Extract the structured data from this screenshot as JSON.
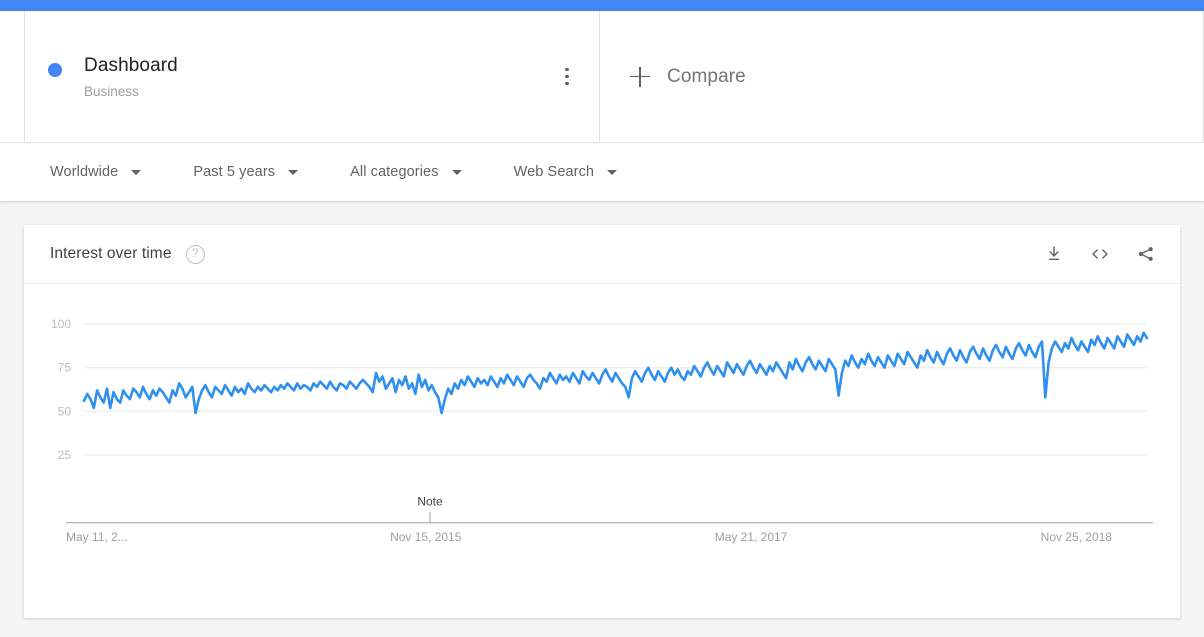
{
  "topbar": {
    "color": "#4285f4"
  },
  "query": {
    "dot_color": "#4285f4",
    "title": "Dashboard",
    "subtitle": "Business",
    "menu_icon": "more-vert-icon"
  },
  "compare": {
    "icon": "plus-icon",
    "label": "Compare"
  },
  "filters": [
    {
      "label": "Worldwide",
      "icon": "chevron-down-icon"
    },
    {
      "label": "Past 5 years",
      "icon": "chevron-down-icon"
    },
    {
      "label": "All categories",
      "icon": "chevron-down-icon"
    },
    {
      "label": "Web Search",
      "icon": "chevron-down-icon"
    }
  ],
  "card": {
    "title": "Interest over time",
    "help_icon": "help-circle-icon",
    "help_glyph": "?",
    "actions": [
      {
        "name": "download-icon",
        "label": "Download"
      },
      {
        "name": "embed-code-icon",
        "label": "Embed"
      },
      {
        "name": "share-icon",
        "label": "Share"
      }
    ]
  },
  "chart_data": {
    "type": "line",
    "title": "Interest over time",
    "xlabel": "",
    "ylabel": "",
    "ylim": [
      0,
      108
    ],
    "yticks": [
      25,
      50,
      75,
      100
    ],
    "grid": true,
    "legend": false,
    "line_color": "#2f90ee",
    "xticks": [
      {
        "label": "May 11, 2...",
        "position": 0.0
      },
      {
        "label": "Nov 15, 2015",
        "position": 0.3215
      },
      {
        "label": "May 21, 2017",
        "position": 0.6275
      },
      {
        "label": "Nov 25, 2018",
        "position": 0.9335
      }
    ],
    "annotations": [
      {
        "label": "Note",
        "position": 0.3255
      }
    ],
    "series": [
      {
        "name": "Dashboard",
        "color": "#2f90ee",
        "values": [
          56,
          60,
          57,
          52,
          62,
          58,
          55,
          63,
          52,
          61,
          57,
          55,
          62,
          59,
          57,
          63,
          61,
          58,
          64,
          60,
          57,
          62,
          59,
          63,
          61,
          58,
          55,
          62,
          59,
          66,
          63,
          58,
          61,
          64,
          49,
          57,
          62,
          65,
          61,
          58,
          64,
          62,
          60,
          65,
          62,
          59,
          64,
          61,
          63,
          60,
          66,
          63,
          61,
          64,
          62,
          65,
          63,
          61,
          64,
          62,
          65,
          63,
          66,
          64,
          62,
          66,
          63,
          65,
          64,
          62,
          66,
          64,
          67,
          65,
          63,
          67,
          64,
          62,
          66,
          65,
          63,
          67,
          65,
          63,
          66,
          68,
          66,
          64,
          61,
          72,
          67,
          70,
          63,
          66,
          69,
          61,
          68,
          65,
          70,
          63,
          66,
          60,
          71,
          64,
          68,
          62,
          65,
          61,
          58,
          49,
          57,
          63,
          60,
          66,
          63,
          68,
          65,
          70,
          67,
          64,
          69,
          66,
          68,
          65,
          70,
          67,
          64,
          69,
          66,
          71,
          68,
          65,
          70,
          67,
          64,
          69,
          71,
          68,
          66,
          63,
          69,
          67,
          72,
          69,
          66,
          71,
          68,
          70,
          67,
          72,
          69,
          66,
          73,
          70,
          68,
          72,
          69,
          66,
          71,
          74,
          70,
          67,
          72,
          69,
          66,
          64,
          58,
          69,
          73,
          70,
          67,
          72,
          75,
          71,
          68,
          73,
          70,
          67,
          72,
          75,
          71,
          74,
          70,
          68,
          73,
          71,
          76,
          73,
          70,
          75,
          78,
          74,
          71,
          76,
          73,
          70,
          78,
          75,
          72,
          77,
          74,
          71,
          76,
          79,
          75,
          72,
          77,
          74,
          71,
          76,
          73,
          78,
          75,
          72,
          69,
          78,
          74,
          80,
          76,
          73,
          78,
          81,
          77,
          74,
          79,
          76,
          73,
          80,
          77,
          74,
          59,
          72,
          79,
          76,
          82,
          78,
          75,
          80,
          77,
          83,
          79,
          76,
          81,
          78,
          75,
          82,
          79,
          76,
          83,
          80,
          77,
          84,
          81,
          78,
          75,
          82,
          79,
          85,
          81,
          78,
          84,
          80,
          77,
          83,
          86,
          82,
          79,
          85,
          81,
          78,
          84,
          87,
          83,
          80,
          86,
          82,
          79,
          85,
          88,
          84,
          81,
          87,
          83,
          80,
          86,
          89,
          85,
          82,
          88,
          84,
          81,
          87,
          90,
          58,
          78,
          86,
          90,
          87,
          84,
          89,
          86,
          92,
          88,
          85,
          90,
          87,
          84,
          91,
          88,
          93,
          89,
          86,
          92,
          89,
          86,
          93,
          90,
          87,
          94,
          91,
          88,
          93,
          90,
          95,
          92
        ]
      }
    ]
  }
}
